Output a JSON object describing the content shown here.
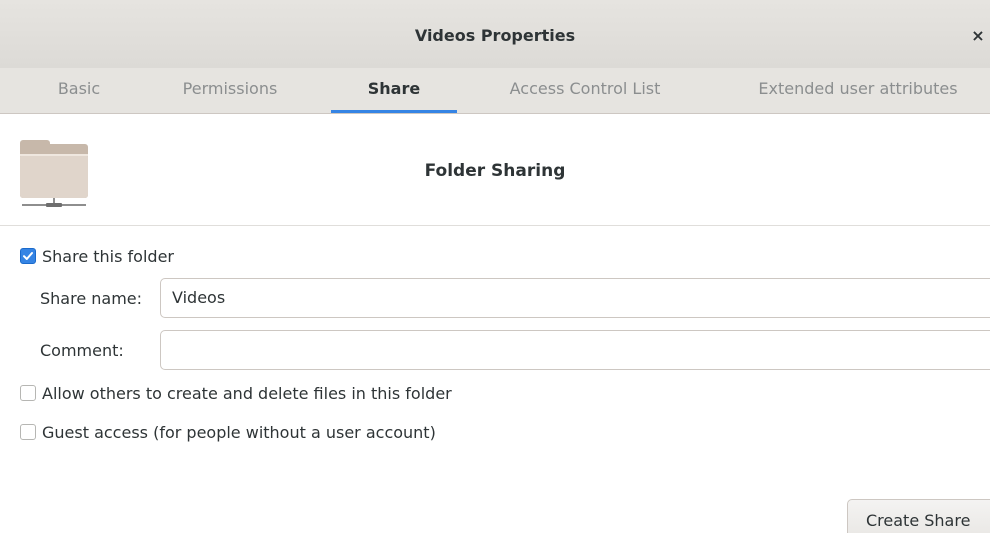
{
  "window": {
    "title": "Videos Properties",
    "close_glyph": "×"
  },
  "tabs": [
    {
      "label": "Basic",
      "active": false
    },
    {
      "label": "Permissions",
      "active": false
    },
    {
      "label": "Share",
      "active": true
    },
    {
      "label": "Access Control List",
      "active": false
    },
    {
      "label": "Extended user attributes",
      "active": false
    }
  ],
  "share": {
    "section_title": "Folder Sharing",
    "folder_icon": "folder-remote-icon",
    "share_checkbox": {
      "label": "Share this folder",
      "checked": true
    },
    "share_name": {
      "label": "Share name:",
      "value": "Videos"
    },
    "comment": {
      "label": "Comment:",
      "value": ""
    },
    "allow_others": {
      "label": "Allow others to create and delete files in this folder",
      "checked": false
    },
    "guest_access": {
      "label": "Guest access (for people without a user account)",
      "checked": false
    },
    "create_button": "Create Share"
  },
  "colors": {
    "accent": "#3584e4",
    "titlebar": "#dcdad6",
    "folder": "#d8cbbf"
  }
}
